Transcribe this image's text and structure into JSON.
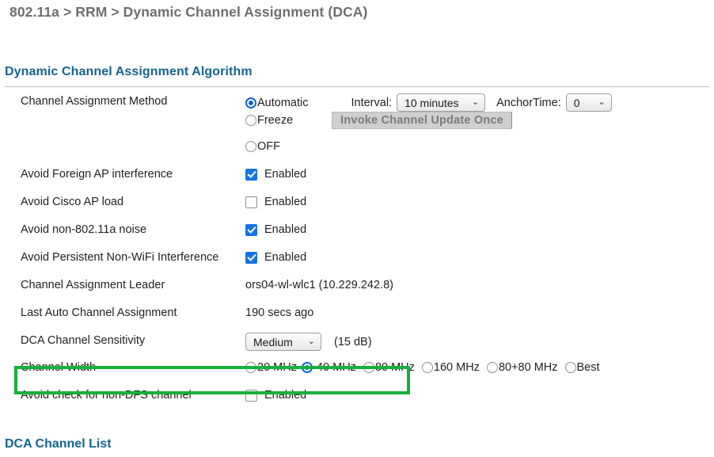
{
  "breadcrumb": "802.11a > RRM > Dynamic Channel Assignment (DCA)",
  "section": {
    "title": "Dynamic Channel Assignment Algorithm",
    "footer_title": "DCA Channel List"
  },
  "colors": {
    "heading": "#14648f",
    "breadcrumb": "#6d6e71",
    "accent_blue": "#0b63d6",
    "checkbox_blue": "#1573e6",
    "highlight_green": "#16b03a"
  },
  "rows": {
    "channel_assignment_method": {
      "label": "Channel Assignment Method",
      "options": [
        {
          "label": "Automatic",
          "selected": true
        },
        {
          "label": "Freeze",
          "selected": false
        },
        {
          "label": "OFF",
          "selected": false
        }
      ],
      "interval_label": "Interval:",
      "interval_value": "10 minutes",
      "anchor_label": "AnchorTime:",
      "anchor_value": "0",
      "invoke_button": "Invoke Channel Update Once"
    },
    "avoid_foreign_ap": {
      "label": "Avoid Foreign AP interference",
      "checkbox_label": "Enabled",
      "checked": true
    },
    "avoid_cisco_ap_load": {
      "label": "Avoid Cisco AP load",
      "checkbox_label": "Enabled",
      "checked": false
    },
    "avoid_non_80211a_noise": {
      "label": "Avoid non-802.11a noise",
      "checkbox_label": "Enabled",
      "checked": true
    },
    "avoid_persistent_non_wifi": {
      "label": "Avoid Persistent Non-WiFi Interference",
      "checkbox_label": "Enabled",
      "checked": true
    },
    "channel_assignment_leader": {
      "label": "Channel Assignment Leader",
      "value": "ors04-wl-wlc1 (10.229.242.8)"
    },
    "last_auto_channel_assignment": {
      "label": "Last Auto Channel Assignment",
      "value": "190 secs ago"
    },
    "dca_channel_sensitivity": {
      "label": "DCA Channel Sensitivity",
      "value": "Medium",
      "note": "(15 dB)"
    },
    "channel_width": {
      "label": "Channel Width",
      "highlighted": true,
      "options": [
        {
          "label": "20 MHz",
          "selected": false
        },
        {
          "label": "40 MHz",
          "selected": true
        },
        {
          "label": "80 MHz",
          "selected": false
        },
        {
          "label": "160 MHz",
          "selected": false
        },
        {
          "label": "80+80 MHz",
          "selected": false
        },
        {
          "label": "Best",
          "selected": false
        }
      ]
    },
    "avoid_check_non_dfs": {
      "label": "Avoid check for non-DFS channel",
      "checkbox_label": "Enabled",
      "checked": false
    }
  },
  "icons": {
    "chevron_down": "⌄"
  }
}
